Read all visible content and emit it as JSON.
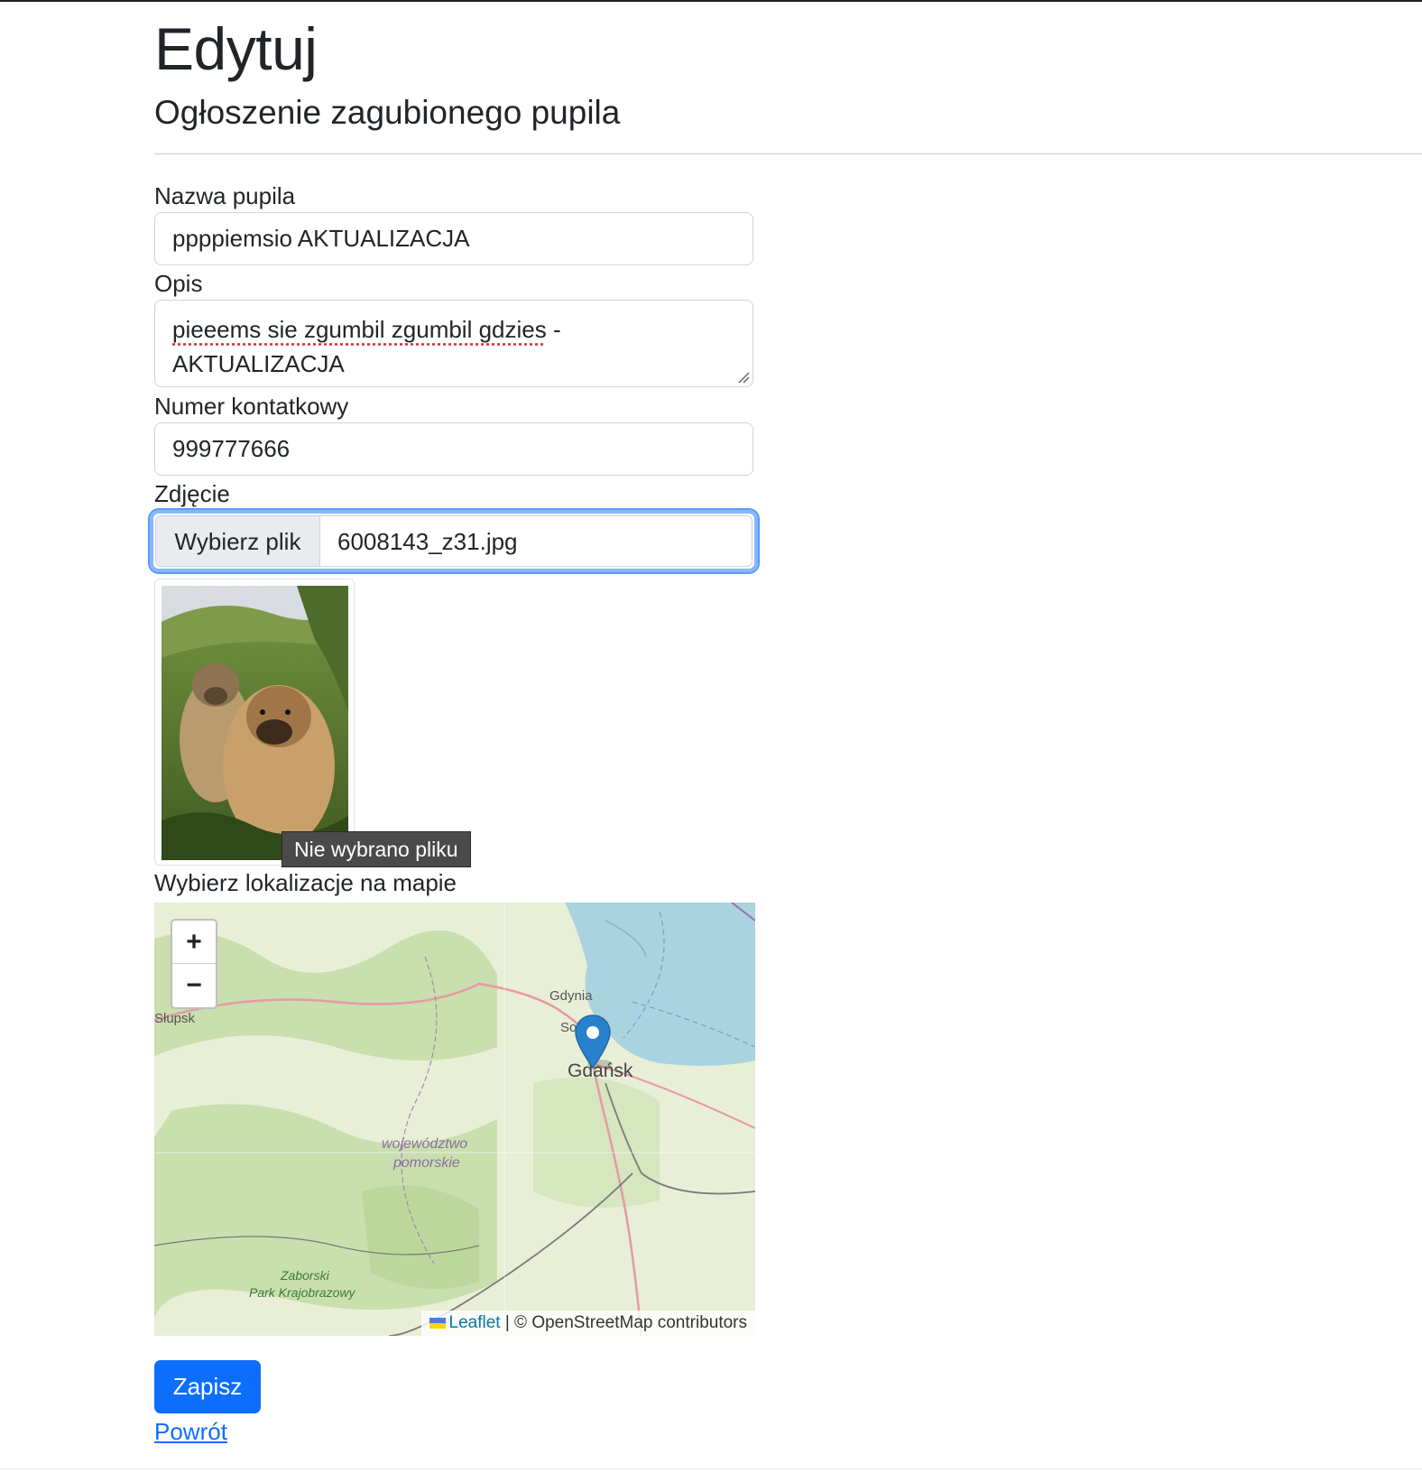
{
  "page": {
    "title": "Edytuj",
    "subtitle": "Ogłoszenie zagubionego pupila"
  },
  "form": {
    "name_label": "Nazwa pupila",
    "name_value": "ppppiemsio AKTUALIZACJA",
    "description_label": "Opis",
    "description_value_part1": "pieeems sie zgumbil zgumbil gdzies",
    "description_value_part2": " - AKTUALIZACJA",
    "phone_label": "Numer kontatkowy",
    "phone_value": "999777666",
    "photo_label": "Zdjęcie",
    "file_button_label": "Wybierz plik",
    "file_name": "6008143_z31.jpg",
    "file_tooltip": "Nie wybrano pliku",
    "map_label": "Wybierz lokalizacje na mapie"
  },
  "map": {
    "zoom_in": "+",
    "zoom_out": "−",
    "places": {
      "gdynia": "Gdynia",
      "sopot": "So",
      "gdansk": "Gdańsk",
      "slupsk": "Słupsk",
      "region_line1": "województwo",
      "region_line2": "pomorskie",
      "park_line1": "Zaborski",
      "park_line2": "Park Krajobrazowy"
    },
    "attribution_link": "Leaflet",
    "attribution_text": " | © OpenStreetMap contributors",
    "colors": {
      "sea": "#aad3df",
      "land": "#e8efd6",
      "forest": "#c9dfae",
      "marker": "#2a81cb"
    }
  },
  "actions": {
    "save_label": "Zapisz",
    "back_label": "Powrót"
  },
  "colors": {
    "primary": "#0d6efd",
    "focus_ring": "#86b7fe"
  }
}
